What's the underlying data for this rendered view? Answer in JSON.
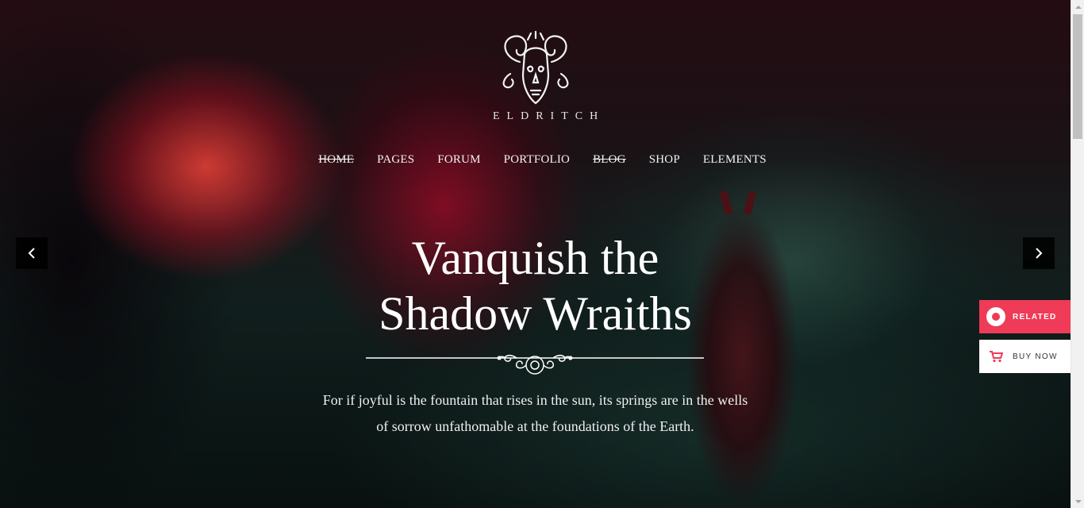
{
  "brand": {
    "name": "ELDRITCH",
    "logo_icon": "ram-skull-icon"
  },
  "nav": {
    "items": [
      {
        "label": "HOME",
        "struck": true
      },
      {
        "label": "PAGES",
        "struck": false
      },
      {
        "label": "FORUM",
        "struck": false
      },
      {
        "label": "PORTFOLIO",
        "struck": false
      },
      {
        "label": "BLOG",
        "struck": true
      },
      {
        "label": "SHOP",
        "struck": false
      },
      {
        "label": "ELEMENTS",
        "struck": false
      }
    ]
  },
  "slider": {
    "prev_icon": "chevron-left-icon",
    "next_icon": "chevron-right-icon"
  },
  "hero": {
    "title_line1": "Vanquish the",
    "title_line2": "Shadow Wraiths",
    "subtitle_line1": "For if joyful is the fountain that rises in the sun, its springs are in the wells",
    "subtitle_line2": "of sorrow unfathomable at the foundations of the Earth."
  },
  "side_buttons": {
    "related_label": "RELATED",
    "related_icon": "related-circle-icon",
    "buy_label": "BUY NOW",
    "buy_icon": "cart-icon"
  },
  "colors": {
    "accent": "#ef3b57",
    "text": "#ffffff",
    "arrow_bg": "#000000"
  }
}
